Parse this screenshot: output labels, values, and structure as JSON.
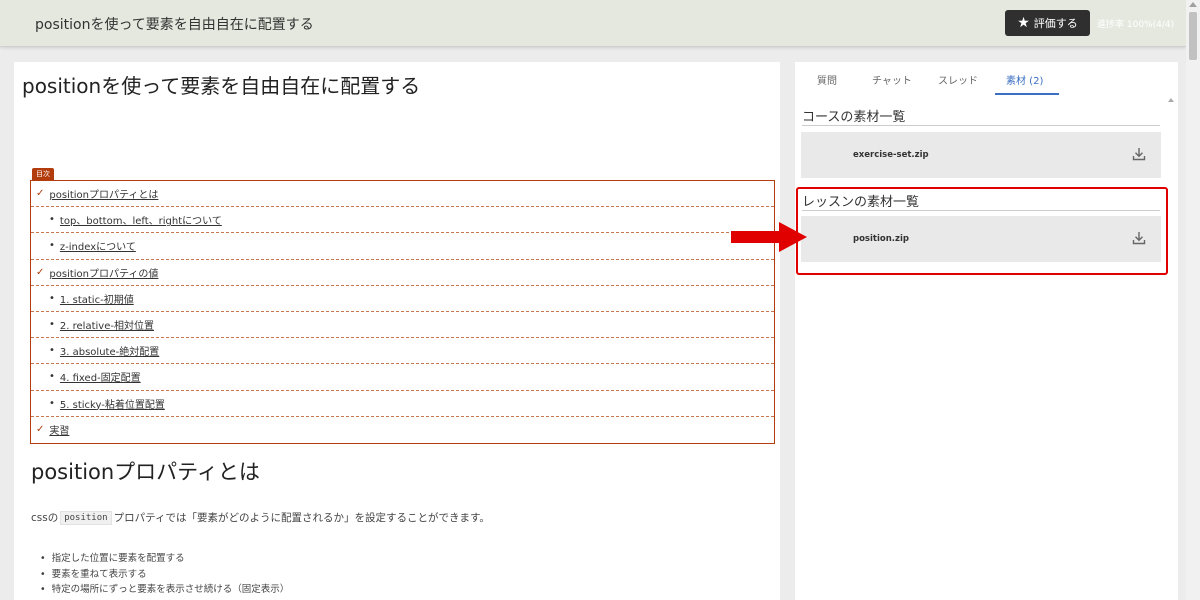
{
  "header": {
    "title": "positionを使って要素を自由自在に配置する",
    "rate_button_label": "評価する",
    "progress_text": "進捗率 100%(4/4)"
  },
  "article": {
    "title": "positionを使って要素を自由自在に配置する",
    "toc_badge": "目次",
    "toc": [
      {
        "level": 1,
        "label": "positionプロパティとは"
      },
      {
        "level": 2,
        "label": "top、bottom、left、rightについて"
      },
      {
        "level": 2,
        "label": "z-indexについて"
      },
      {
        "level": 1,
        "label": "positionプロパティの値"
      },
      {
        "level": 2,
        "label": "1. static-初期値"
      },
      {
        "level": 2,
        "label": "2. relative-相対位置"
      },
      {
        "level": 2,
        "label": "3. absolute-絶対配置"
      },
      {
        "level": 2,
        "label": "4. fixed-固定配置"
      },
      {
        "level": 2,
        "label": "5. sticky-粘着位置配置"
      },
      {
        "level": 1,
        "label": "実習"
      }
    ],
    "section_heading": "positionプロパティとは",
    "paragraph": {
      "before": "cssの",
      "code": "position",
      "after": "プロパティでは「要素がどのように配置されるか」を設定することができます。"
    },
    "bullets": [
      "指定した位置に要素を配置する",
      "要素を重ねて表示する",
      "特定の場所にずっと要素を表示させ続ける（固定表示）"
    ]
  },
  "side_panel": {
    "tabs": [
      {
        "label": "質問",
        "active": false
      },
      {
        "label": "チャット",
        "active": false
      },
      {
        "label": "スレッド",
        "active": false
      },
      {
        "label": "素材 (2)",
        "active": true
      }
    ],
    "course_section_title": "コースの素材一覧",
    "course_files": [
      "exercise-set.zip"
    ],
    "lesson_section_title": "レッスンの素材一覧",
    "lesson_files": [
      "position.zip"
    ]
  },
  "colors": {
    "highlight": "#e00000",
    "toc_accent": "#b33c0c",
    "tab_active": "#3a6fc2"
  }
}
